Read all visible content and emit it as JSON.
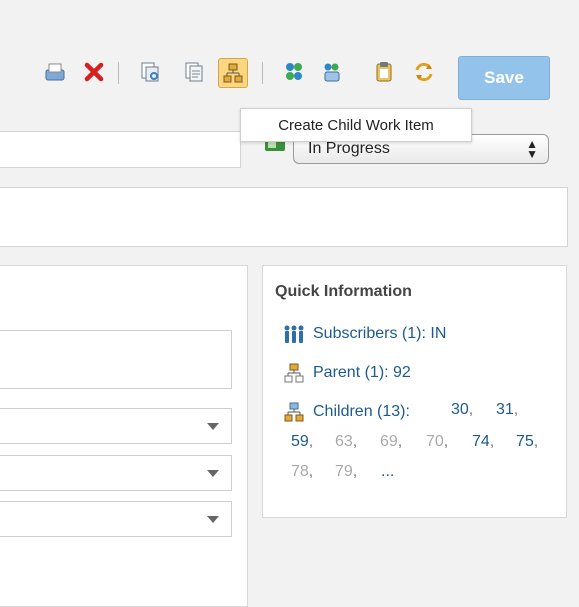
{
  "toolbar": {
    "save_label": "Save",
    "tooltip": "Create Child Work Item"
  },
  "status": {
    "value": "In Progress"
  },
  "quick_info": {
    "title": "Quick Information",
    "subscribers": "Subscribers (1): IN",
    "parent": "Parent (1): 92",
    "children_label": "Children (13):",
    "children": [
      {
        "id": "30",
        "style": "link"
      },
      {
        "id": "31",
        "style": "link"
      },
      {
        "id": "59",
        "style": "link"
      },
      {
        "id": "63",
        "style": "dim"
      },
      {
        "id": "69",
        "style": "dim"
      },
      {
        "id": "70",
        "style": "dim"
      },
      {
        "id": "74",
        "style": "link"
      },
      {
        "id": "75",
        "style": "link"
      },
      {
        "id": "78",
        "style": "dim"
      },
      {
        "id": "79",
        "style": "dim"
      }
    ],
    "ellipsis": "...",
    "colors": {
      "link": "#1c5a8f",
      "dim": "#a9a9a9"
    }
  }
}
